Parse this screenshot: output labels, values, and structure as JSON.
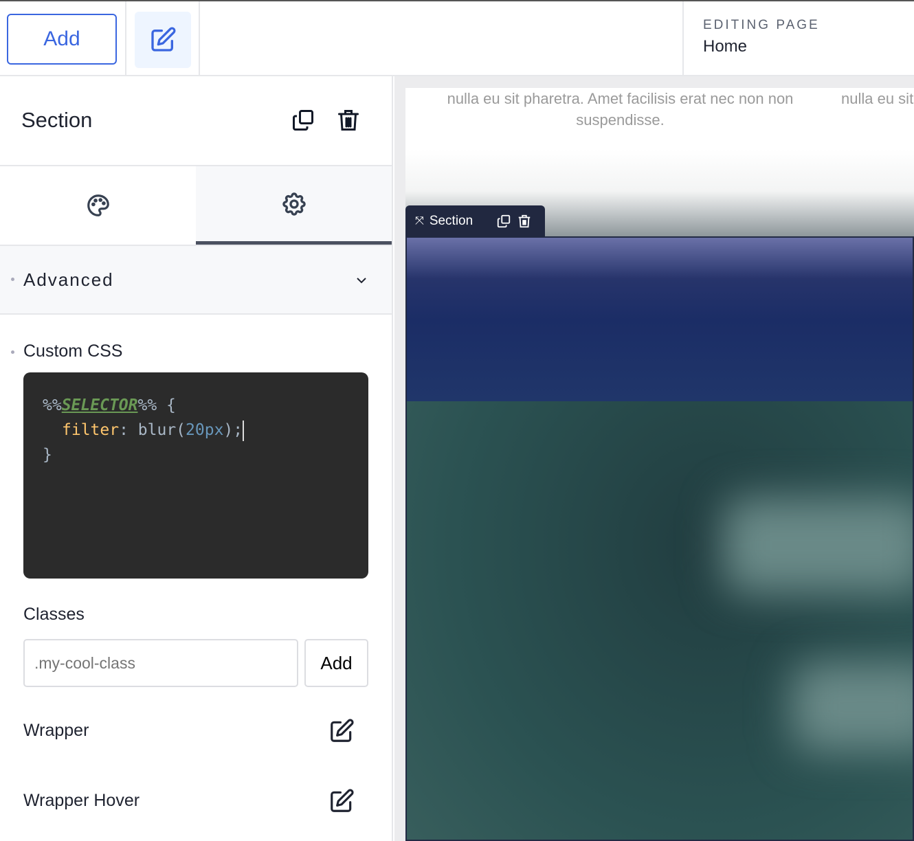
{
  "toolbar": {
    "add_label": "Add",
    "editing_label": "EDITING PAGE",
    "editing_value": "Home"
  },
  "panel": {
    "title": "Section",
    "advanced_label": "Advanced",
    "custom_css_label": "Custom CSS",
    "code": {
      "pre": "%%",
      "selector": "SELECTOR",
      "post": "%% {",
      "property": "filter",
      "colon": ": blur(",
      "value": "20px",
      "end": ");",
      "close": "}"
    },
    "classes_label": "Classes",
    "classes_placeholder": ".my-cool-class",
    "classes_add": "Add",
    "wrapper_label": "Wrapper",
    "wrapper_hover_label": "Wrapper Hover"
  },
  "canvas": {
    "lorem_1": "nulla eu sit pharetra. Amet facilisis erat nec non non suspendisse.",
    "lorem_2": "nulla eu sit",
    "section_label": "Section"
  },
  "colors": {
    "accent": "#3a66e0",
    "editor_bg": "#2b2b2b",
    "toolbar_bg": "#212840"
  }
}
